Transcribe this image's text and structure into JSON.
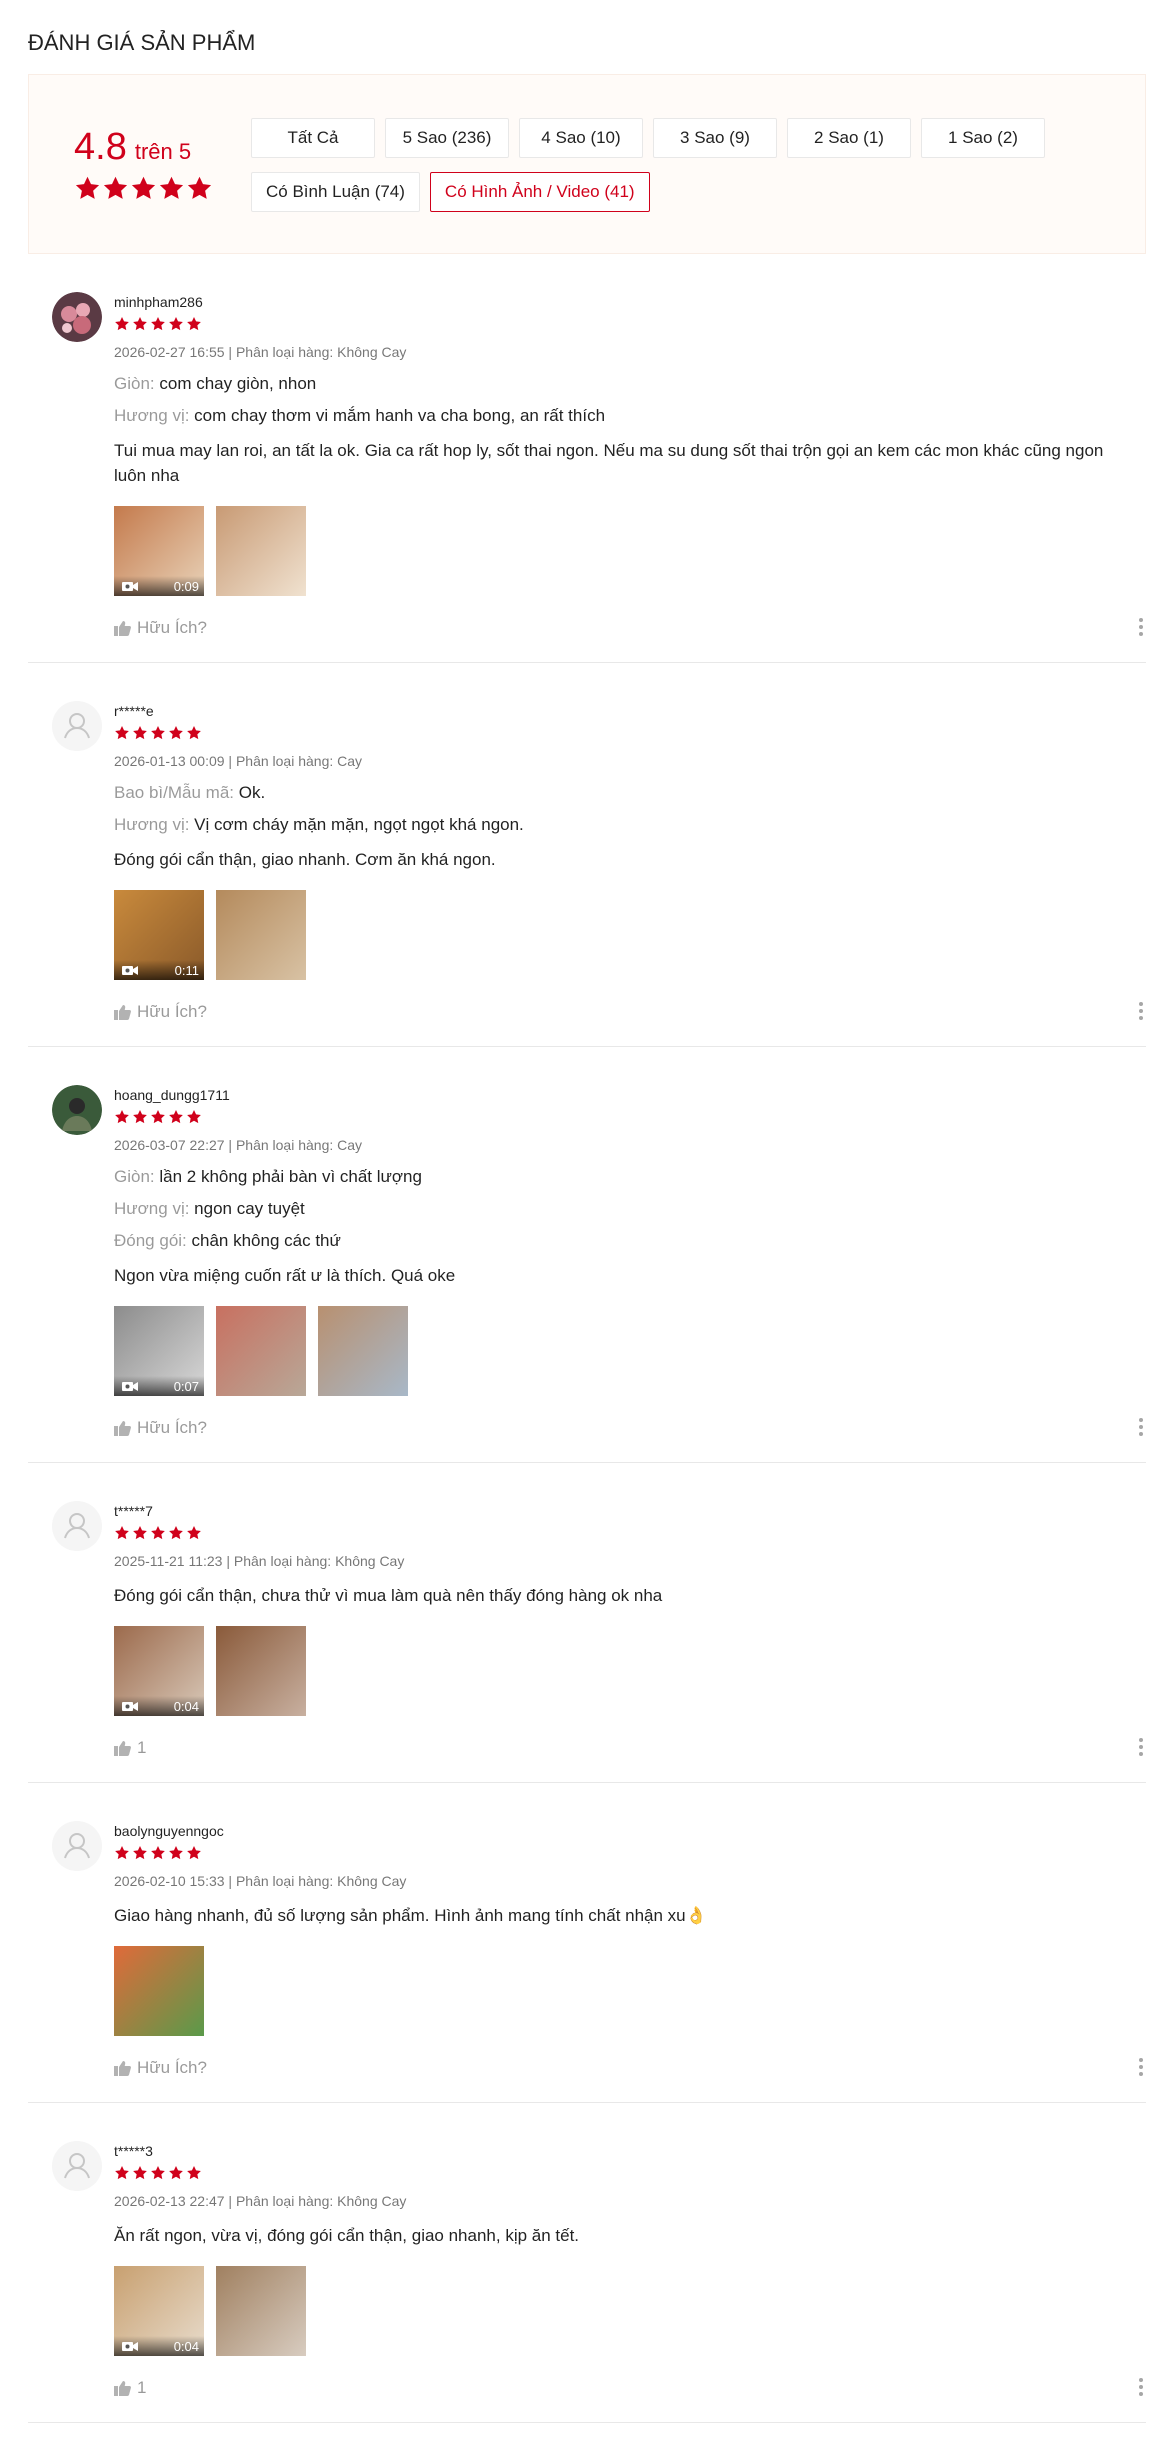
{
  "header": {
    "title": "ĐÁNH GIÁ SẢN PHẨM"
  },
  "overview": {
    "rating": "4.8",
    "rating_of": "trên 5",
    "stars": 5,
    "filters": [
      "Tất Cả",
      "5 Sao (236)",
      "4 Sao (10)",
      "3 Sao (9)",
      "2 Sao (1)",
      "1 Sao (2)",
      "Có Bình Luận (74)",
      "Có Hình Ảnh / Video (41)"
    ],
    "active_filter": "Có Hình Ảnh / Video (41)"
  },
  "colors": {
    "accent": "#d0011b",
    "panel_bg": "#fffbf8"
  },
  "helpful_default": "Hữu Ích?",
  "reviews": [
    {
      "user": "minhpham286",
      "stars": 5,
      "meta": "2026-02-27 16:55 | Phân loại hàng: Không Cay",
      "avatar": "photo",
      "attrs": [
        {
          "label": "Giòn:",
          "value": "com chay giòn, nhon"
        },
        {
          "label": "Hương vị:",
          "value": "com chay thơm vi mắm hanh va cha bong, an rất thích"
        }
      ],
      "comment": "Tui mua may lan roi, an tất la ok. Gia ca rất hop ly, sốt thai ngon. Nếu ma su dung sốt thai trộn gọi an kem các mon khác cũng ngon luôn nha",
      "media": [
        {
          "type": "video",
          "duration": "0:09",
          "colors": [
            "#c47a4c",
            "#e8d2b8"
          ]
        },
        {
          "type": "image",
          "colors": [
            "#c89a74",
            "#f0e2d0"
          ]
        }
      ],
      "helpful": "Hữu Ích?"
    },
    {
      "user": "r*****e",
      "stars": 5,
      "meta": "2026-01-13 00:09 | Phân loại hàng: Cay",
      "avatar": "default",
      "attrs": [
        {
          "label": "Bao bì/Mẫu mã:",
          "value": "Ok."
        },
        {
          "label": "Hương vị:",
          "value": "Vị cơm cháy mặn mặn, ngọt ngọt khá ngon."
        }
      ],
      "comment": "Đóng gói cẩn thận, giao nhanh. Cơm ăn khá ngon.",
      "media": [
        {
          "type": "video",
          "duration": "0:11",
          "colors": [
            "#c98a3c",
            "#8a5a2a"
          ]
        },
        {
          "type": "image",
          "colors": [
            "#b48a5c",
            "#d8c2a4"
          ]
        }
      ],
      "helpful": "Hữu Ích?"
    },
    {
      "user": "hoang_dungg1711",
      "stars": 5,
      "meta": "2026-03-07 22:27 | Phân loại hàng: Cay",
      "avatar": "photo2",
      "attrs": [
        {
          "label": "Giòn:",
          "value": "lần 2 không phải bàn vì chất lượng"
        },
        {
          "label": "Hương vị:",
          "value": "ngon cay tuyệt"
        },
        {
          "label": "Đóng gói:",
          "value": "chân không các thứ"
        }
      ],
      "comment": "Ngon vừa miệng cuốn rất ư là thích. Quá oke",
      "media": [
        {
          "type": "video",
          "duration": "0:07",
          "colors": [
            "#8c8c8c",
            "#d8d8d8"
          ]
        },
        {
          "type": "image",
          "colors": [
            "#c87060",
            "#b8a898"
          ]
        },
        {
          "type": "image",
          "colors": [
            "#b89070",
            "#a8b8c8"
          ]
        }
      ],
      "helpful": "Hữu Ích?"
    },
    {
      "user": "t*****7",
      "stars": 5,
      "meta": "2025-11-21 11:23 | Phân loại hàng: Không Cay",
      "avatar": "default",
      "attrs": [],
      "comment": "Đóng gói cẩn thận, chưa thử vì mua làm quà nên thấy đóng hàng ok nha",
      "media": [
        {
          "type": "video",
          "duration": "0:04",
          "colors": [
            "#9c6a4c",
            "#d8c8b8"
          ]
        },
        {
          "type": "image",
          "colors": [
            "#8a5a3a",
            "#c8b0a0"
          ]
        }
      ],
      "helpful": "1"
    },
    {
      "user": "baolynguyenngoc",
      "stars": 5,
      "meta": "2026-02-10 15:33 | Phân loại hàng: Không Cay",
      "avatar": "default",
      "attrs": [],
      "comment": "Giao hàng nhanh, đủ số lượng sản phẩm. Hình ảnh mang tính chất nhận xu👌",
      "media": [
        {
          "type": "image",
          "colors": [
            "#e06a3a",
            "#5a9a4a"
          ]
        }
      ],
      "helpful": "Hữu Ích?"
    },
    {
      "user": "t*****3",
      "stars": 5,
      "meta": "2026-02-13 22:47 | Phân loại hàng: Không Cay",
      "avatar": "default",
      "attrs": [],
      "comment": "Ăn rất ngon, vừa vị, đóng gói cẩn thận, giao nhanh, kịp ăn tết.",
      "media": [
        {
          "type": "video",
          "duration": "0:04",
          "colors": [
            "#c8a070",
            "#e8dccc"
          ]
        },
        {
          "type": "image",
          "colors": [
            "#a08060",
            "#d8ccc0"
          ]
        }
      ],
      "helpful": "1"
    }
  ]
}
